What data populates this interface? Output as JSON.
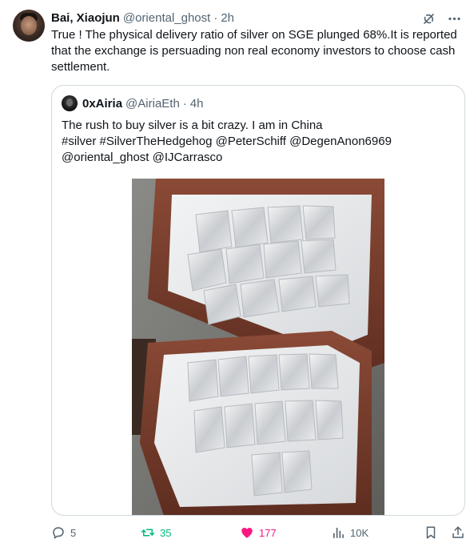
{
  "tweet": {
    "author_name": "Bai, Xiaojun",
    "author_handle": "@oriental_ghost",
    "separator": "·",
    "time": "2h",
    "text": "True ! The physical delivery ratio of silver on SGE plunged 68%.It is reported that the exchange is persuading non real economy investors to choose cash settlement."
  },
  "top_actions": {
    "grok_icon": "grok-icon",
    "more_icon": "more-icon"
  },
  "quote": {
    "author_name": "0xAiria",
    "author_handle": "@AiriaEth",
    "separator": "·",
    "time": "4h",
    "text_lines": [
      "The rush to buy silver is a bit crazy. I am in China",
      "#silver #SilverTheHedgehog @PeterSchiff @DegenAnon6969",
      "@oriental_ghost @IJCarrasco"
    ]
  },
  "actions": {
    "replies": "5",
    "retweets": "35",
    "likes": "177",
    "views": "10K"
  },
  "colors": {
    "retweet": "#00ba7c",
    "like": "#f91880",
    "muted": "#536471",
    "border": "#cfd9de"
  }
}
